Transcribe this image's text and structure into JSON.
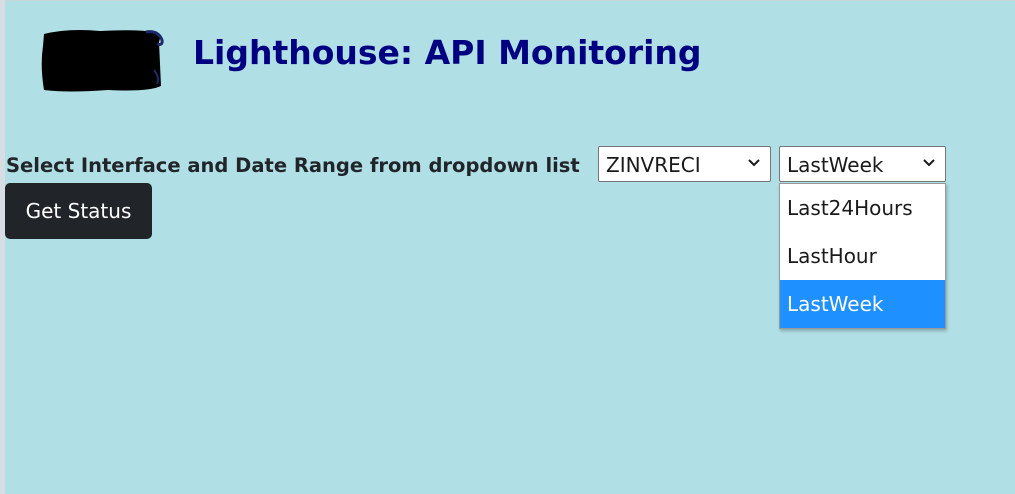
{
  "header": {
    "title": "Lighthouse: API Monitoring",
    "logo_icon": "redacted-logo-icon"
  },
  "form": {
    "prompt": "Select Interface and Date Range from dropdown list",
    "interface_select": {
      "selected": "ZINVRECI"
    },
    "range_select": {
      "selected": "LastWeek",
      "expanded": true,
      "options": [
        "Last24Hours",
        "LastHour",
        "LastWeek"
      ],
      "highlighted": "LastWeek"
    },
    "submit_label": "Get Status"
  },
  "colors": {
    "background": "#b0dfe5",
    "title": "#000080",
    "button_bg": "#212529",
    "option_highlight": "#1e90ff"
  }
}
